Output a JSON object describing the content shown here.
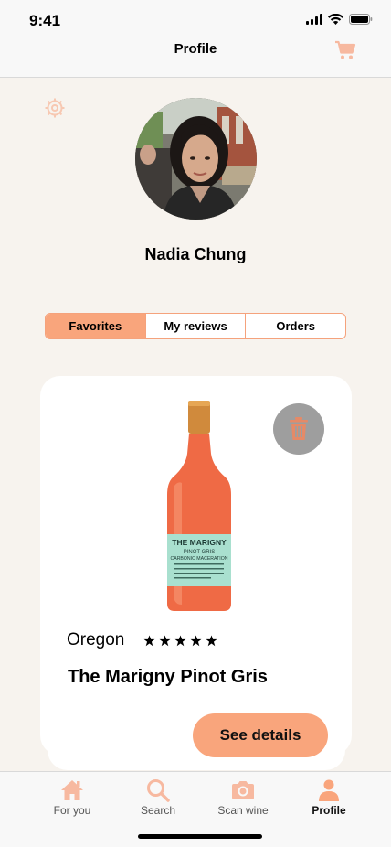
{
  "status": {
    "time": "9:41"
  },
  "header": {
    "title": "Profile"
  },
  "profile": {
    "name": "Nadia Chung"
  },
  "segments": [
    {
      "label": "Favorites",
      "active": true
    },
    {
      "label": "My reviews",
      "active": false
    },
    {
      "label": "Orders",
      "active": false
    }
  ],
  "favorite": {
    "region": "Oregon",
    "rating": 5,
    "name": "The Marigny Pinot Gris",
    "button_label": "See details",
    "bottle_label": {
      "line1": "THE MARIGNY",
      "line2": "PINOT GRIS",
      "line3": "CARBONIC MACERATION"
    }
  },
  "tabs": [
    {
      "label": "For you",
      "icon": "home-icon",
      "active": false
    },
    {
      "label": "Search",
      "icon": "search-icon",
      "active": false
    },
    {
      "label": "Scan wine",
      "icon": "camera-icon",
      "active": false
    },
    {
      "label": "Profile",
      "icon": "person-icon",
      "active": true
    }
  ],
  "colors": {
    "accent": "#f9a57c",
    "background": "#f7f3ee",
    "card": "#ffffff",
    "delete_button": "#9e9e9e"
  }
}
